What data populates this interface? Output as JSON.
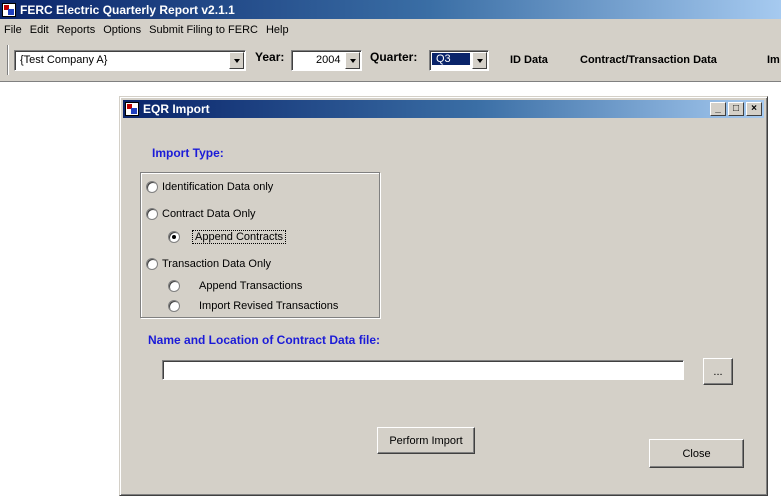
{
  "app": {
    "title": "FERC Electric Quarterly Report v2.1.1"
  },
  "menu": [
    "File",
    "Edit",
    "Reports",
    "Options",
    "Submit Filing to FERC",
    "Help"
  ],
  "toolbar": {
    "company": "{Test Company A}",
    "year_label": "Year:",
    "year_value": "2004",
    "quarter_label": "Quarter:",
    "quarter_value": "Q3",
    "nav": [
      "ID Data",
      "Contract/Transaction Data",
      "Im"
    ]
  },
  "dialog": {
    "title": "EQR Import",
    "import_type_label": "Import Type:",
    "options": {
      "identification": "Identification Data only",
      "contract": "Contract Data Only",
      "append_contracts": "Append Contracts",
      "transaction": "Transaction Data Only",
      "append_transactions": "Append Transactions",
      "import_revised": "Import Revised Transactions"
    },
    "selected_option": "append_contracts",
    "file_label": "Name and Location of Contract Data file:",
    "file_path": "",
    "browse_label": "...",
    "perform_import_label": "Perform Import",
    "close_label": "Close",
    "min_glyph": "_",
    "max_glyph": "□",
    "close_glyph": "×"
  }
}
